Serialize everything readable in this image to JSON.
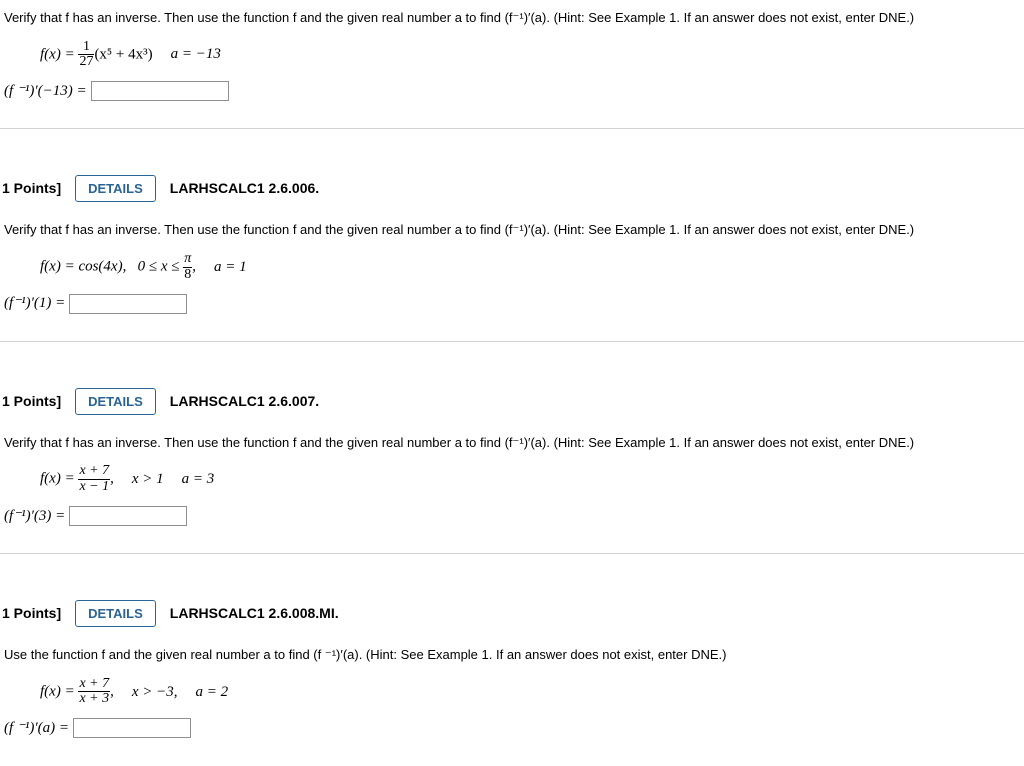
{
  "common": {
    "instr_a": "Verify that f has an inverse. Then use the function f and the given real number a to find  (f⁻¹)′(a).  (Hint: See Example 1. If an answer does not exist, enter DNE.)",
    "instr_b": "Use the function f and the given real number a to find (f ⁻¹)′(a). (Hint: See Example 1. If an answer does not exist, enter DNE.)",
    "points": "1 Points]",
    "details": "DETAILS"
  },
  "q0": {
    "fx_pre": "f(x) = ",
    "frac_num": "1",
    "frac_den": "27",
    "fx_post": "(x⁵ + 4x³)",
    "a": "a = −13",
    "ans_label": "(f ⁻¹)′(−13) = "
  },
  "q1": {
    "qid": "LARHSCALC1 2.6.006.",
    "fx": "f(x) = cos(4x),",
    "cond_pre": "0 ≤ x ≤ ",
    "frac_num": "π",
    "frac_den": "8",
    "cond_post": ",",
    "a": "a = 1",
    "ans_label": "(f⁻¹)′(1) = "
  },
  "q2": {
    "qid": "LARHSCALC1 2.6.007.",
    "fx_pre": "f(x) = ",
    "frac_num": "x + 7",
    "frac_den": "x − 1",
    "fx_post": ",",
    "cond": "x > 1",
    "a": "a = 3",
    "ans_label": "(f⁻¹)′(3) = "
  },
  "q3": {
    "qid": "LARHSCALC1 2.6.008.MI.",
    "fx_pre": "f(x) = ",
    "frac_num": "x + 7",
    "frac_den": "x + 3",
    "fx_post": ",",
    "cond": "x > −3,",
    "a": "a = 2",
    "ans_label": "(f ⁻¹)′(a)  = "
  }
}
